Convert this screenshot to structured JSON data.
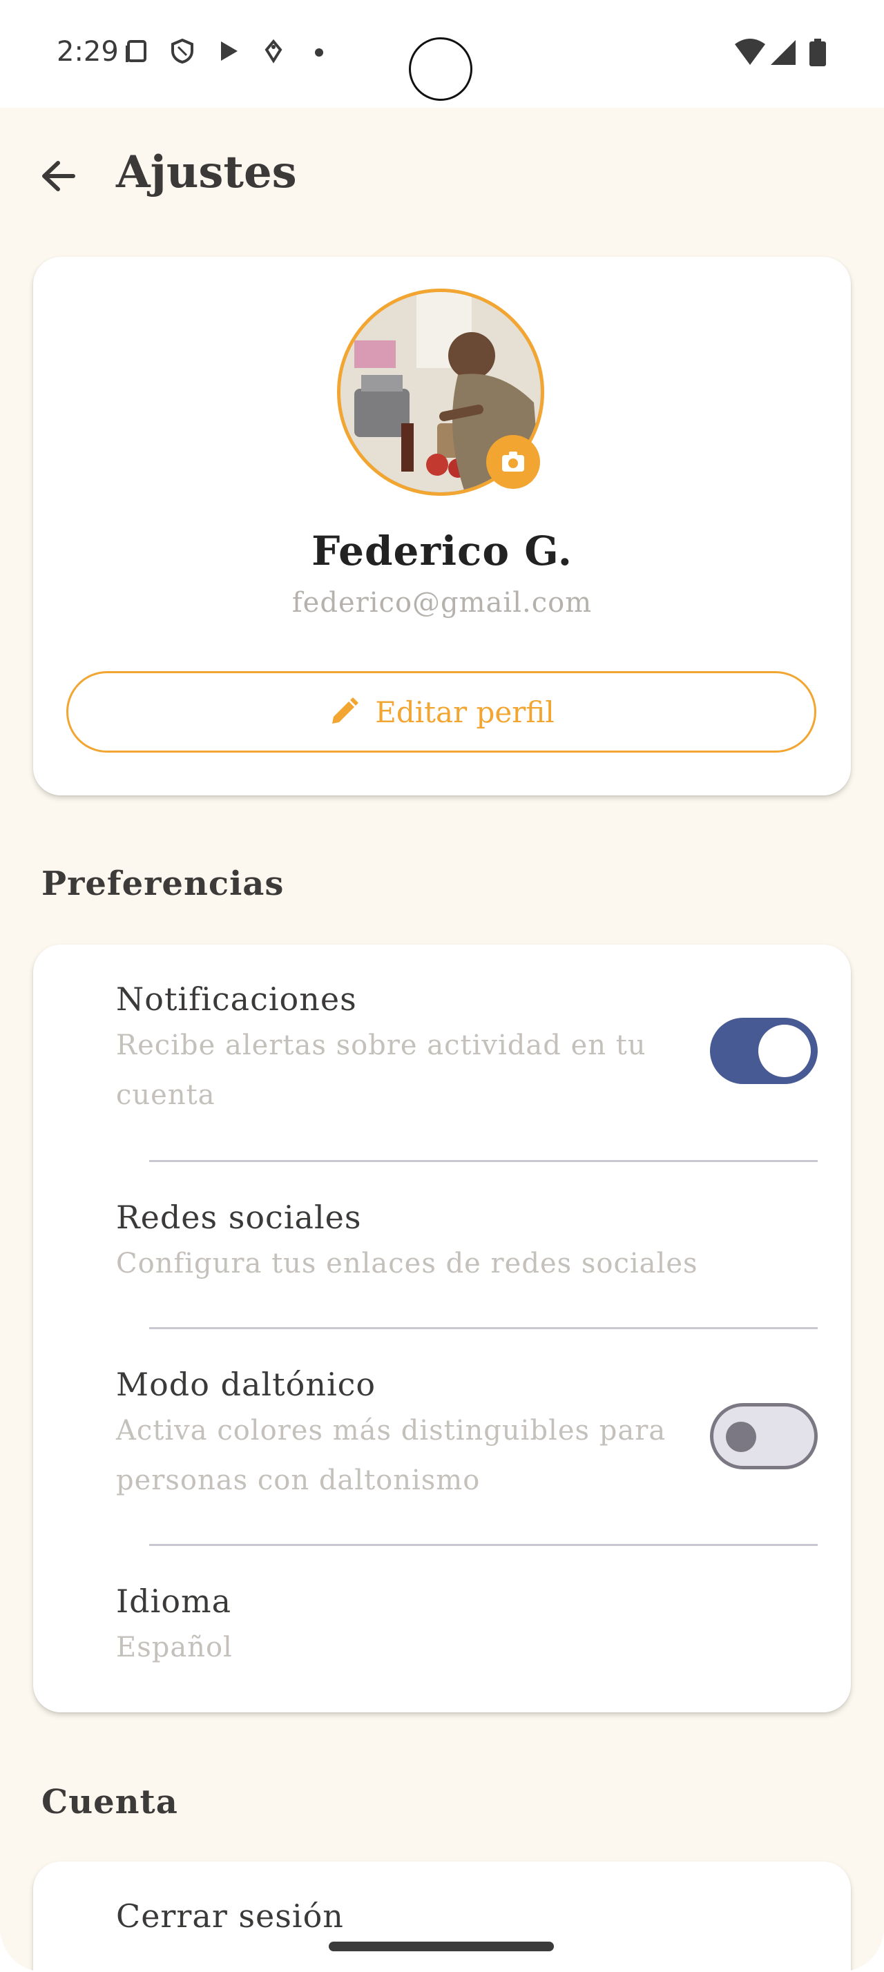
{
  "status_bar": {
    "time": "2:29"
  },
  "header": {
    "title": "Ajustes"
  },
  "profile": {
    "name": "Federico G.",
    "email": "federico@gmail.com",
    "edit_label": "Editar perfil"
  },
  "sections": {
    "preferences_title": "Preferencias",
    "account_title": "Cuenta"
  },
  "preferences": [
    {
      "title": "Notificaciones",
      "subtitle": "Recibe alertas sobre actividad en tu cuenta",
      "toggle": true
    },
    {
      "title": "Redes sociales",
      "subtitle": "Configura tus enlaces de redes sociales"
    },
    {
      "title": "Modo daltónico",
      "subtitle": "Activa colores más distinguibles para personas con daltonismo",
      "toggle": false
    },
    {
      "title": "Idioma",
      "subtitle": "Español"
    }
  ],
  "account": {
    "items": [
      {
        "title": "Cerrar sesión"
      }
    ]
  },
  "colors": {
    "accent": "#f2a531",
    "toggle_on": "#485a93",
    "background": "#fcf8ef"
  }
}
